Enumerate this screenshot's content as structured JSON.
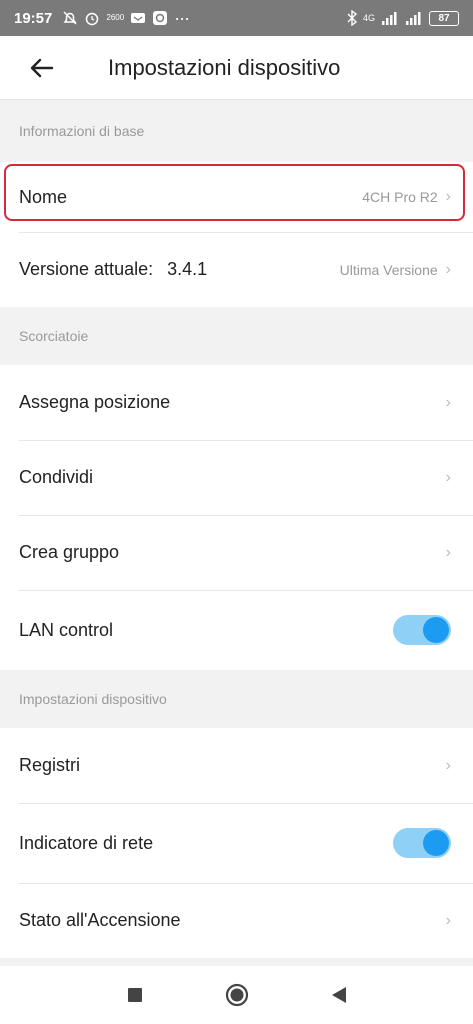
{
  "status_bar": {
    "time": "19:57",
    "left_icons": [
      "mute-alarm-icon",
      "alarm-clock-icon",
      "data-speed-icon",
      "notification-icon",
      "app-icon",
      "more-dots-icon"
    ],
    "data_speed": "2600",
    "network": "4G",
    "battery": "87"
  },
  "header": {
    "title": "Impostazioni dispositivo"
  },
  "sections": {
    "basic_info": {
      "label": "Informazioni di base",
      "name_label": "Nome",
      "name_value": "4CH Pro R2",
      "version_label": "Versione attuale:",
      "version_number": "3.4.1",
      "version_status": "Ultima Versione"
    },
    "shortcuts": {
      "label": "Scorciatoie",
      "assign_position": "Assegna posizione",
      "share": "Condividi",
      "create_group": "Crea gruppo",
      "lan_control": "LAN control",
      "lan_control_on": true
    },
    "device_settings": {
      "label": "Impostazioni dispositivo",
      "logs": "Registri",
      "network_indicator": "Indicatore di rete",
      "network_indicator_on": true,
      "power_on_state": "Stato all'Accensione"
    }
  },
  "colors": {
    "accent": "#1c9bf0",
    "toggle_track": "#8fd0f6",
    "highlight": "#d42b3a"
  }
}
